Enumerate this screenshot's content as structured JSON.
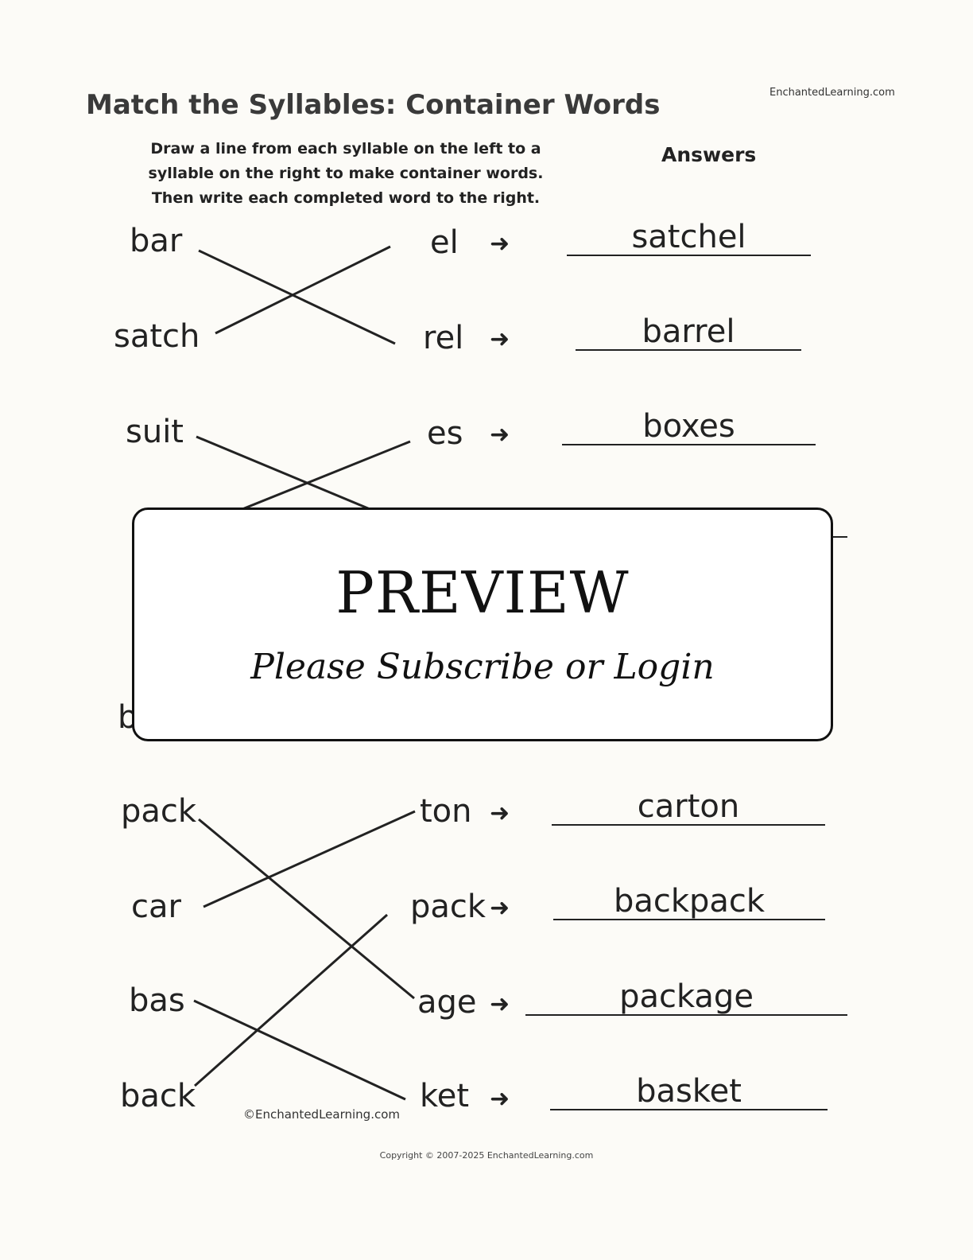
{
  "header": {
    "title": "Match the Syllables: Container Words",
    "site": "EnchantedLearning.com"
  },
  "instructions": "Draw a line from each syllable on the left to a syllable on the right to make container words. Then write each completed word to the right.",
  "answers_label": "Answers",
  "group1": {
    "left": [
      "bar",
      "satch",
      "suit"
    ],
    "right": [
      "el",
      "rel",
      "es"
    ],
    "answers": [
      "satchel",
      "barrel",
      "boxes"
    ]
  },
  "hidden_left": "b",
  "group2": {
    "left": [
      "pack",
      "car",
      "bas",
      "back"
    ],
    "right": [
      "ton",
      "pack",
      "age",
      "ket"
    ],
    "answers": [
      "carton",
      "backpack",
      "package",
      "basket"
    ]
  },
  "arrow_icon": "right-arrow",
  "preview": {
    "title": "PREVIEW",
    "subtitle": "Please Subscribe or Login"
  },
  "footer": {
    "inner_copyright": "©EnchantedLearning.com",
    "copyright": "Copyright © 2007-2025 EnchantedLearning.com"
  }
}
